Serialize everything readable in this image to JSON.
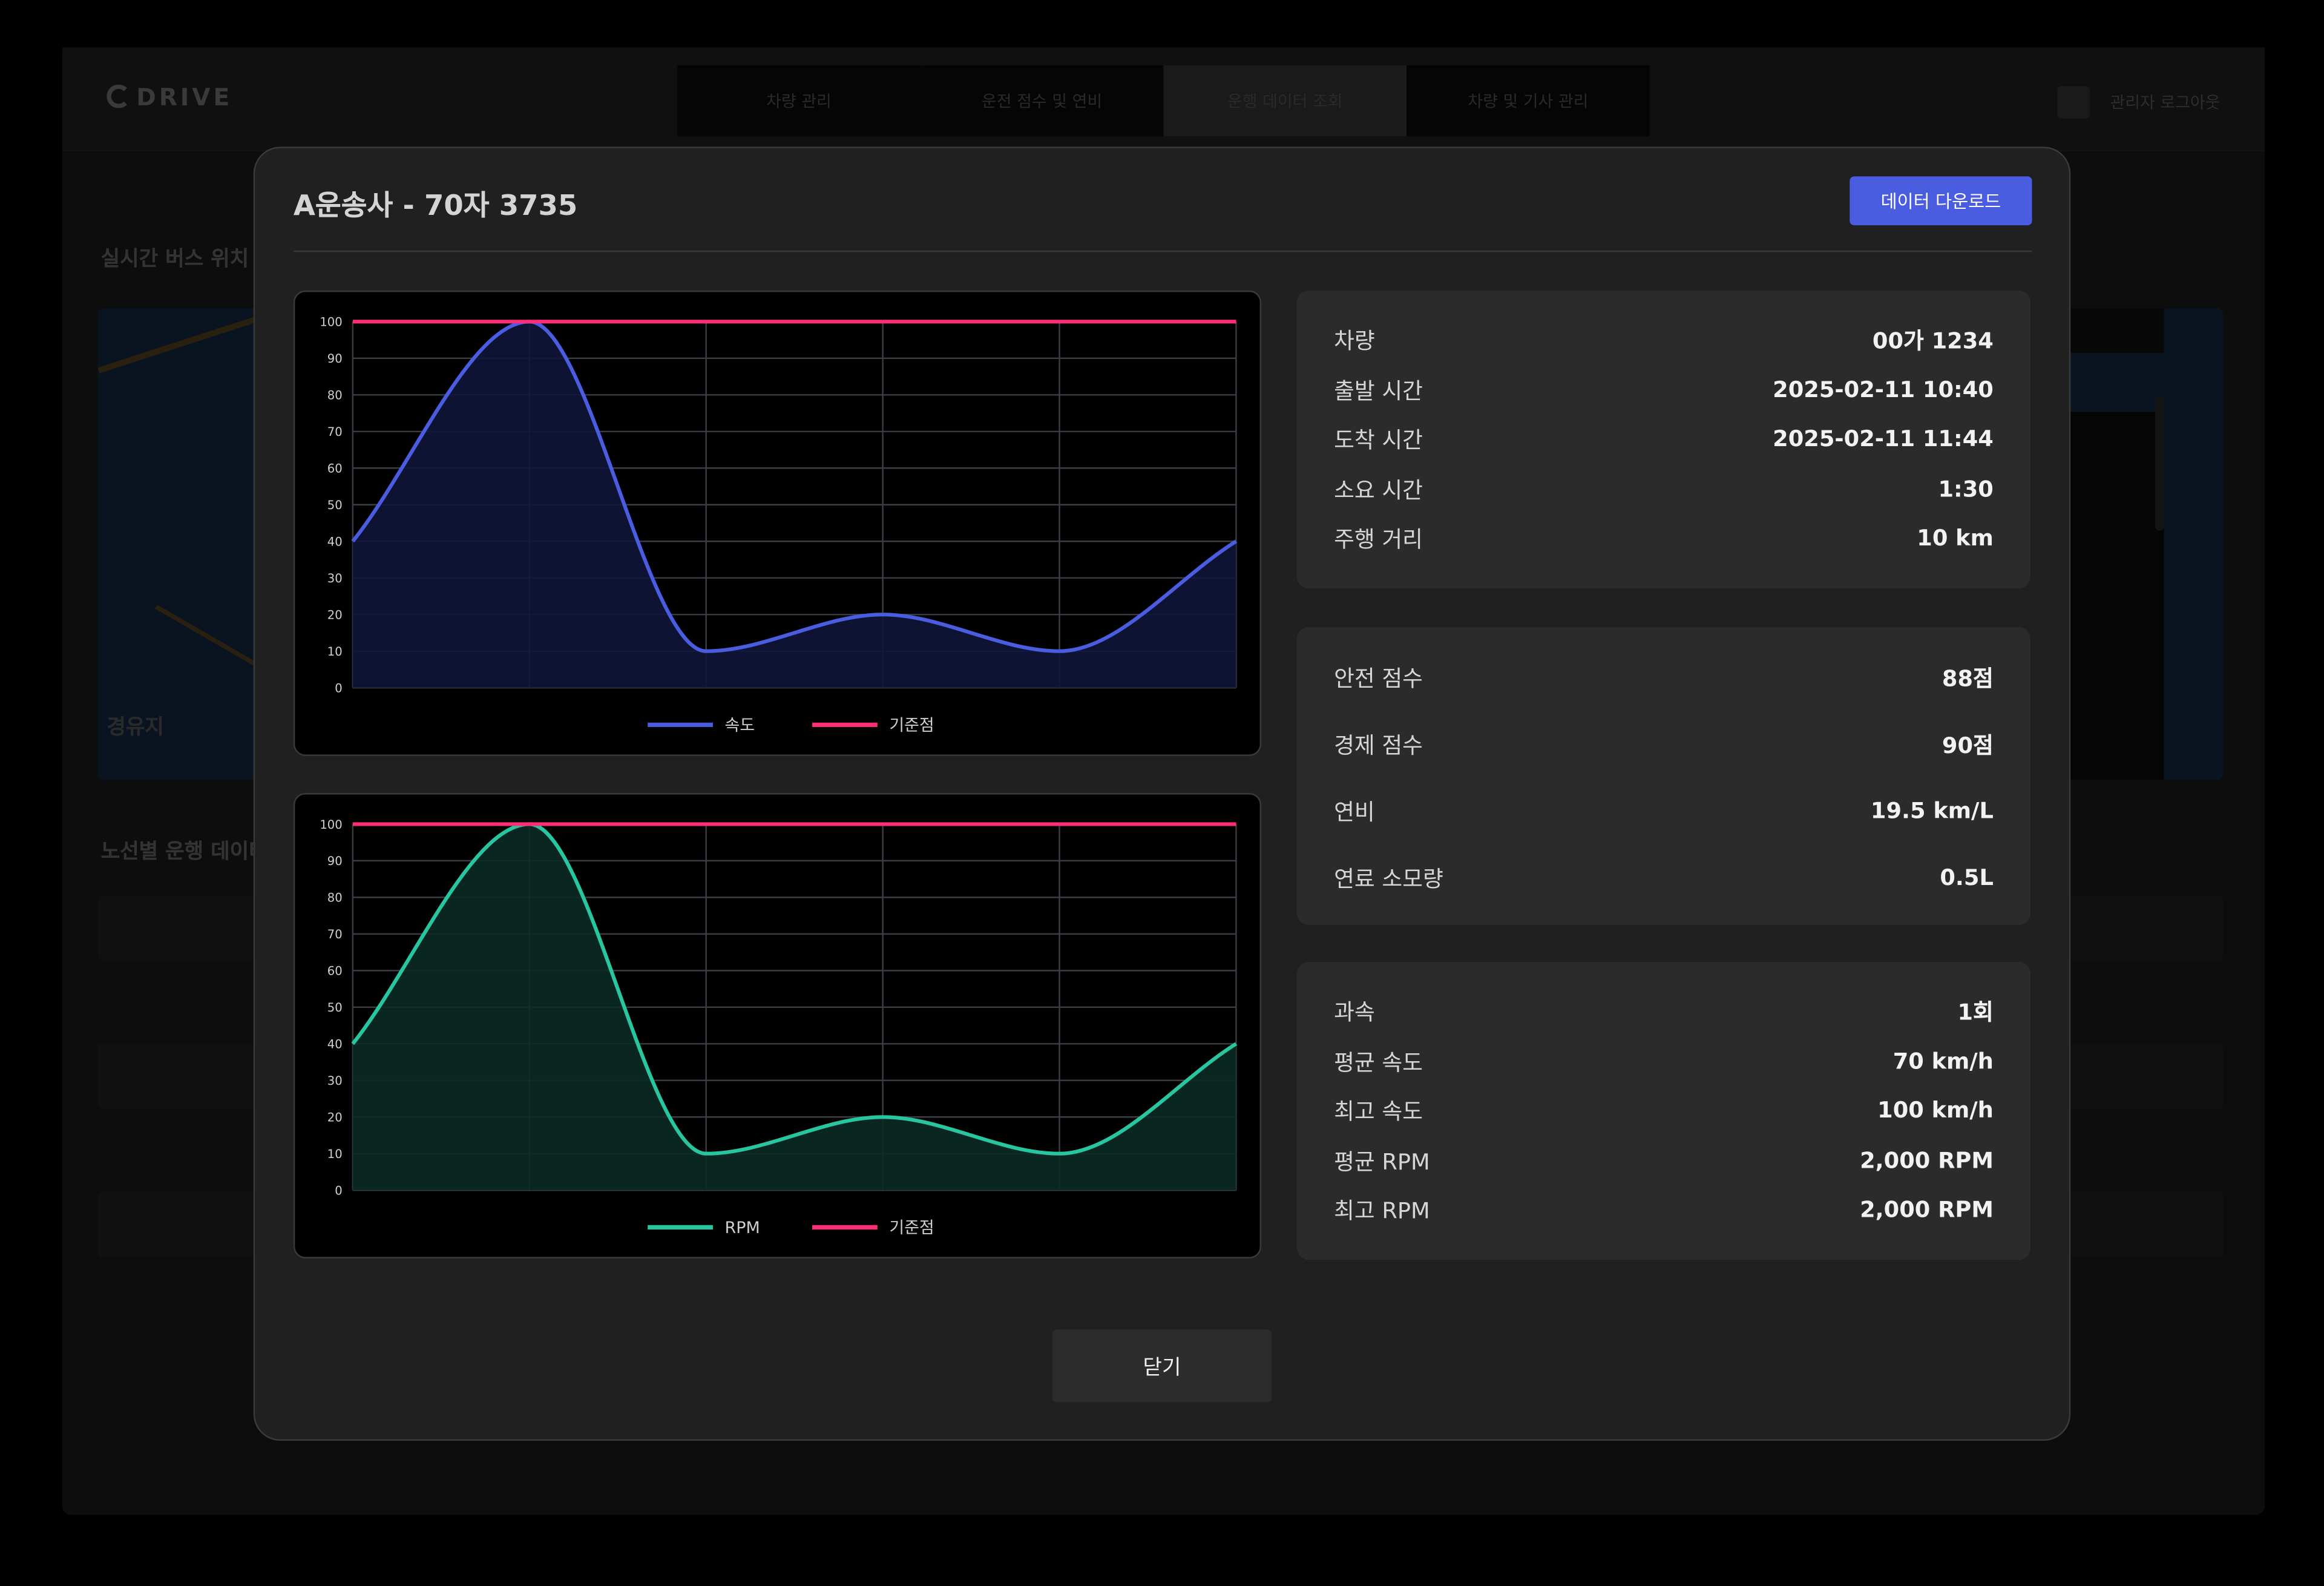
{
  "background": {
    "logo": "DRIVE",
    "tabs": [
      "차량 관리",
      "운전 점수 및 연비",
      "운행 데이터 조회",
      "차량 및 기사 관리"
    ],
    "user": "관리자 로그아웃",
    "section_live": "실시간 버스 위치",
    "section_routes": "노선별 운행 데이터",
    "map_label": "경유지"
  },
  "modal": {
    "title": "A운송사 - 70자 3735",
    "download_label": "데이터 다운로드",
    "close_label": "닫기"
  },
  "colors": {
    "speed_line": "#4a5ce0",
    "speed_fill": "#10153a",
    "rpm_line": "#27c6a0",
    "rpm_fill": "#0b2a24",
    "baseline": "#ff2d78",
    "accent": "#4a5ce0"
  },
  "trip_info": [
    {
      "label": "차량",
      "value": "00가 1234"
    },
    {
      "label": "출발 시간",
      "value": "2025-02-11 10:40"
    },
    {
      "label": "도착 시간",
      "value": "2025-02-11 11:44"
    },
    {
      "label": "소요 시간",
      "value": "1:30"
    },
    {
      "label": "주행 거리",
      "value": "10 km"
    }
  ],
  "scores": [
    {
      "label": "안전 점수",
      "value": "88점"
    },
    {
      "label": "경제 점수",
      "value": "90점"
    },
    {
      "label": "연비",
      "value": "19.5 km/L"
    },
    {
      "label": "연료 소모량",
      "value": "0.5L"
    }
  ],
  "driving_stats": [
    {
      "label": "과속",
      "value": "1회"
    },
    {
      "label": "평균 속도",
      "value": "70 km/h"
    },
    {
      "label": "최고 속도",
      "value": "100 km/h"
    },
    {
      "label": "평균 RPM",
      "value": "2,000 RPM"
    },
    {
      "label": "최고 RPM",
      "value": "2,000 RPM"
    }
  ],
  "chart_data": [
    {
      "type": "area",
      "x": [
        0,
        1,
        2,
        3,
        4,
        5
      ],
      "series": [
        {
          "name": "속도",
          "values": [
            40,
            100,
            10,
            20,
            10,
            40
          ],
          "style": "smooth-area"
        },
        {
          "name": "기준점",
          "values": [
            100,
            100,
            100,
            100,
            100,
            100
          ],
          "style": "line"
        }
      ],
      "yticks": [
        0,
        10,
        20,
        30,
        40,
        50,
        60,
        70,
        80,
        90,
        100
      ],
      "ylim": [
        0,
        100
      ],
      "grid": true,
      "legend": "bottom-center"
    },
    {
      "type": "area",
      "x": [
        0,
        1,
        2,
        3,
        4,
        5
      ],
      "series": [
        {
          "name": "RPM",
          "values": [
            40,
            100,
            10,
            20,
            10,
            40
          ],
          "style": "smooth-area"
        },
        {
          "name": "기준점",
          "values": [
            100,
            100,
            100,
            100,
            100,
            100
          ],
          "style": "line"
        }
      ],
      "yticks": [
        0,
        10,
        20,
        30,
        40,
        50,
        60,
        70,
        80,
        90,
        100
      ],
      "ylim": [
        0,
        100
      ],
      "grid": true,
      "legend": "bottom-center"
    }
  ]
}
